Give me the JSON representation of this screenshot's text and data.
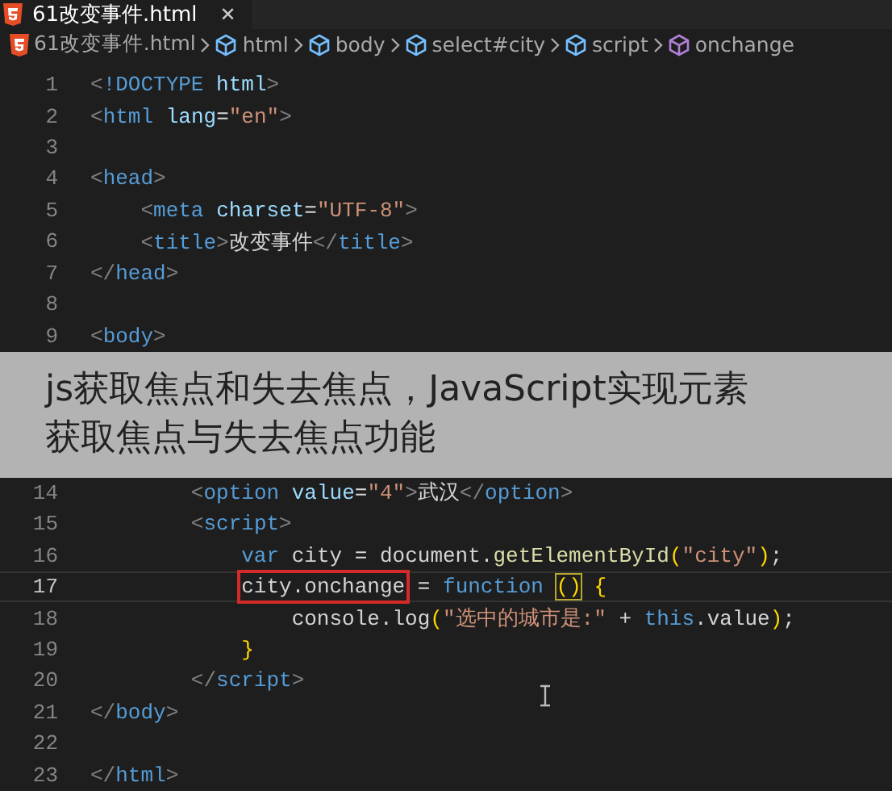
{
  "tab": {
    "title": "61改变事件.html",
    "close": "✕",
    "selected": true
  },
  "breadcrumbs": [
    {
      "kind": "file",
      "label": "61改变事件.html"
    },
    {
      "kind": "element",
      "label": "html"
    },
    {
      "kind": "element",
      "label": "body"
    },
    {
      "kind": "element",
      "label": "select#city"
    },
    {
      "kind": "element",
      "label": "script"
    },
    {
      "kind": "method",
      "label": "onchange"
    }
  ],
  "lines": [
    {
      "kind": "code",
      "number": "1",
      "current": false,
      "segments": [
        {
          "text": "<!DOCTYPE html>"
        }
      ]
    },
    {
      "kind": "code",
      "number": "2",
      "current": false,
      "segments": [
        {
          "text": "<html lang=\"en\">"
        }
      ]
    },
    {
      "kind": "code",
      "number": "3",
      "current": false
    },
    {
      "kind": "code",
      "number": "4",
      "current": false,
      "segments": [
        {
          "text": "<head>"
        }
      ]
    },
    {
      "kind": "code",
      "number": "5",
      "current": false,
      "segments": [
        {
          "text": "    <meta charset=\"UTF-8\">"
        }
      ]
    },
    {
      "kind": "code",
      "number": "6",
      "current": false,
      "segments": [
        {
          "text": "    <title>改变事件</title>"
        }
      ]
    },
    {
      "kind": "code",
      "number": "7",
      "current": false,
      "segments": [
        {
          "text": "</head>"
        }
      ]
    },
    {
      "kind": "code",
      "number": "8",
      "current": false
    },
    {
      "kind": "code",
      "number": "9",
      "current": false,
      "segments": [
        {
          "text": "<body>"
        }
      ]
    },
    {
      "kind": "caption",
      "text": [
        "js获取焦点和失去焦点，JavaScript实现元素",
        "获取焦点与失去焦点功能"
      ]
    },
    {
      "kind": "code",
      "number": "14",
      "current": false,
      "segments": [
        {
          "text": "        <option value=\"4\">武汉</option>"
        }
      ]
    },
    {
      "kind": "code",
      "number": "15",
      "current": false,
      "segments": [
        {
          "text": "        <script>"
        }
      ]
    },
    {
      "kind": "code",
      "number": "16",
      "current": false,
      "segments": [
        {
          "text": "            var city = document.getElementById(\"city\");"
        }
      ]
    },
    {
      "kind": "code",
      "number": "17",
      "current": true,
      "segments": [
        {
          "text": "            city.onchange",
          "boxed": true
        },
        {
          "text": " = function "
        },
        {
          "text": "()",
          "matched": true
        },
        {
          "text": " {"
        }
      ]
    },
    {
      "kind": "code",
      "number": "18",
      "current": false,
      "segments": [
        {
          "text": "                console.log(\"选中的城市是:\" + this.value);"
        }
      ]
    },
    {
      "kind": "code",
      "number": "19",
      "current": false,
      "segments": [
        {
          "text": "            }"
        }
      ]
    },
    {
      "kind": "code",
      "number": "20",
      "current": false,
      "segments": [
        {
          "text": "        </script>"
        }
      ]
    },
    {
      "kind": "code",
      "number": "21",
      "current": false,
      "segments": [
        {
          "text": "</body>"
        }
      ]
    },
    {
      "kind": "code",
      "number": "22",
      "current": false
    },
    {
      "kind": "code",
      "number": "23",
      "current": false,
      "segments": [
        {
          "text": "</html>"
        }
      ]
    }
  ]
}
